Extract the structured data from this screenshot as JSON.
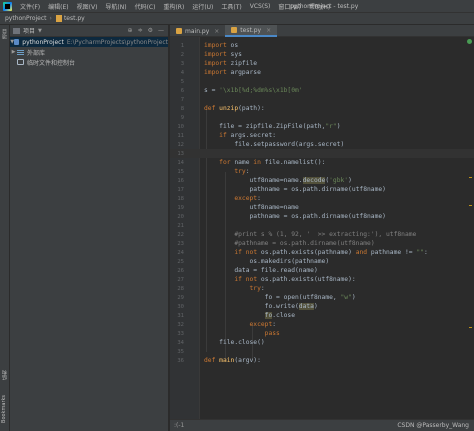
{
  "menu": {
    "items": [
      "文件(F)",
      "编辑(E)",
      "视图(V)",
      "导航(N)",
      "代码(C)",
      "重构(R)",
      "运行(U)",
      "工具(T)",
      "VCS(S)",
      "窗口(W)",
      "帮助(H)"
    ],
    "title": "pythonProject - test.py"
  },
  "navbar": {
    "project": "pythonProject",
    "file": "test.py"
  },
  "left_strip": {
    "top_tab": "项目",
    "middle_tab": "结构",
    "bottom_tab": "Bookmarks"
  },
  "project_panel": {
    "header": "项目",
    "tree": [
      {
        "label": "pythonProject",
        "hint": "E:\\PycharmProjects\\pythonProject"
      },
      {
        "label": "外部库",
        "hint": ""
      },
      {
        "label": "临时文件和控制台",
        "hint": ""
      }
    ]
  },
  "tabs": [
    {
      "label": "main.py",
      "close": "×"
    },
    {
      "label": "test.py",
      "close": "×"
    }
  ],
  "editor": {
    "line_numbers": [
      "1",
      "2",
      "3",
      "4",
      "5",
      "6",
      "7",
      "8",
      "9",
      "10",
      "11",
      "12",
      "13",
      "14",
      "15",
      "16",
      "17",
      "18",
      "19",
      "20",
      "21",
      "22",
      "23",
      "24",
      "25",
      "26",
      "27",
      "28",
      "29",
      "30",
      "31",
      "32",
      "33",
      "34",
      "35",
      "36",
      "37",
      "38",
      "39",
      "40",
      "41"
    ],
    "lines": [
      "import os",
      "import sys",
      "import zipfile",
      "import argparse",
      "",
      "s = '\\x1b[%d;%dm%s\\x1b[0m'",
      "",
      "def unzip(path):",
      "",
      "    file = zipfile.ZipFile(path,\"r\")",
      "    if args.secret:",
      "        file.setpassword(args.secret)",
      "",
      "    for name in file.namelist():",
      "        try:",
      "            utf8name=name.decode('gbk')",
      "            pathname = os.path.dirname(utf8name)",
      "        except:",
      "            utf8name=name",
      "            pathname = os.path.dirname(utf8name)",
      "",
      "        #print s % (1, 92, '  >> extracting:'), utf8name",
      "        #pathname = os.path.dirname(utf8name)",
      "        if not os.path.exists(pathname) and pathname != \"\":",
      "            os.makedirs(pathname)",
      "        data = file.read(name)",
      "        if not os.path.exists(utf8name):",
      "            try:",
      "                fo = open(utf8name, \"w\")",
      "                fo.write(data)",
      "                fo.close",
      "            except:",
      "                pass",
      "    file.close()",
      "",
      "def main(argv):"
    ]
  },
  "statusbar": {
    "position": ":(-1",
    "watermark": "CSDN @Passerby_Wang"
  },
  "colors": {
    "keyword": "#cc7832",
    "function": "#ffc66d",
    "string": "#6a8759",
    "comment": "#808080",
    "text": "#a9b7c6",
    "background": "#2b2b2b"
  }
}
